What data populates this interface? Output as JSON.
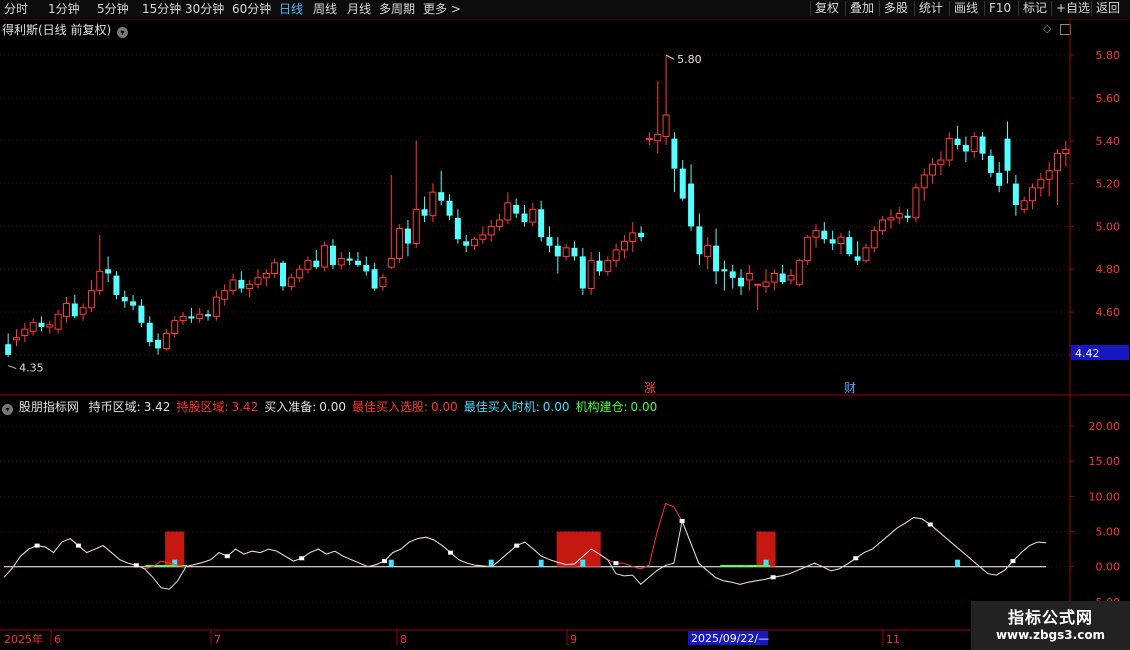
{
  "toolbar": {
    "periods": [
      {
        "label": "分时",
        "active": false
      },
      {
        "label": "1分钟",
        "active": false
      },
      {
        "label": "5分钟",
        "active": false
      },
      {
        "label": "15分钟",
        "active": false
      },
      {
        "label": "30分钟",
        "active": false
      },
      {
        "label": "60分钟",
        "active": false
      },
      {
        "label": "日线",
        "active": true
      },
      {
        "label": "周线",
        "active": false
      },
      {
        "label": "月线",
        "active": false
      },
      {
        "label": "多周期",
        "active": false
      },
      {
        "label": "更多 >",
        "active": false
      }
    ],
    "actions": [
      "复权",
      "叠加",
      "多股",
      "统计",
      "画线",
      "F10",
      "标记",
      "+自选",
      "返回"
    ]
  },
  "main_pane": {
    "title": "得利斯(日线 前复权)",
    "y_ticks": [
      "5.80",
      "5.60",
      "5.40",
      "5.20",
      "5.00",
      "4.80",
      "4.60",
      "4.40"
    ],
    "current_price": "4.42",
    "high_label": "5.80",
    "low_label": "4.35",
    "markers": [
      {
        "label": "涨",
        "color": "#ff4040"
      },
      {
        "label": "财",
        "color": "#4fa8ff"
      }
    ]
  },
  "indicator_pane": {
    "name": "股朋指标网",
    "legend": [
      {
        "label": "持币区域:",
        "value": "3.42",
        "color": "#e0e0e0"
      },
      {
        "label": "持股区域:",
        "value": "3.42",
        "color": "#ff3030"
      },
      {
        "label": "买入准备:",
        "value": "0.00",
        "color": "#e0e0e0"
      },
      {
        "label": "最佳买入选股:",
        "value": "0.00",
        "color": "#ff3030"
      },
      {
        "label": "最佳买入时机:",
        "value": "0.00",
        "color": "#40e0ff"
      },
      {
        "label": "机构建仓:",
        "value": "0.00",
        "color": "#40ff40"
      }
    ],
    "y_ticks": [
      "20.00",
      "15.00",
      "10.00",
      "5.00",
      "0.00",
      "-5.00"
    ]
  },
  "x_axis": {
    "year_label": "2025年",
    "month_labels": [
      "6",
      "7",
      "8",
      "9",
      "11"
    ],
    "cursor_date": "2025/09/22/—"
  },
  "watermark": {
    "line1": "指标公式网",
    "line2": "www.zbgs3.com"
  },
  "colors": {
    "up": "#ff3a3a",
    "down": "#54ffff",
    "grid": "#5a0000",
    "axis": "#a00000"
  },
  "chart_data": [
    {
      "type": "candlestick",
      "title": "得利斯(日线 前复权)",
      "ylim": [
        4.32,
        5.88
      ],
      "y_ticks": [
        5.8,
        5.6,
        5.4,
        5.2,
        5.0,
        4.8,
        4.6,
        4.4
      ],
      "ohlc": [
        [
          4.45,
          4.5,
          4.39,
          4.4
        ],
        [
          4.47,
          4.52,
          4.44,
          4.48
        ],
        [
          4.49,
          4.55,
          4.46,
          4.52
        ],
        [
          4.51,
          4.57,
          4.49,
          4.55
        ],
        [
          4.55,
          4.58,
          4.51,
          4.53
        ],
        [
          4.53,
          4.56,
          4.5,
          4.54
        ],
        [
          4.52,
          4.61,
          4.5,
          4.59
        ],
        [
          4.58,
          4.67,
          4.55,
          4.64
        ],
        [
          4.64,
          4.68,
          4.57,
          4.58
        ],
        [
          4.59,
          4.64,
          4.56,
          4.62
        ],
        [
          4.62,
          4.75,
          4.6,
          4.7
        ],
        [
          4.7,
          4.96,
          4.68,
          4.79
        ],
        [
          4.8,
          4.86,
          4.74,
          4.78
        ],
        [
          4.77,
          4.79,
          4.66,
          4.68
        ],
        [
          4.67,
          4.7,
          4.62,
          4.65
        ],
        [
          4.65,
          4.68,
          4.61,
          4.63
        ],
        [
          4.63,
          4.66,
          4.53,
          4.55
        ],
        [
          4.55,
          4.58,
          4.44,
          4.46
        ],
        [
          4.47,
          4.5,
          4.4,
          4.43
        ],
        [
          4.43,
          4.52,
          4.42,
          4.5
        ],
        [
          4.5,
          4.58,
          4.48,
          4.56
        ],
        [
          4.56,
          4.6,
          4.54,
          4.58
        ],
        [
          4.58,
          4.62,
          4.55,
          4.57
        ],
        [
          4.57,
          4.62,
          4.55,
          4.59
        ],
        [
          4.59,
          4.61,
          4.56,
          4.58
        ],
        [
          4.58,
          4.7,
          4.56,
          4.67
        ],
        [
          4.66,
          4.73,
          4.63,
          4.7
        ],
        [
          4.7,
          4.78,
          4.68,
          4.75
        ],
        [
          4.75,
          4.79,
          4.69,
          4.71
        ],
        [
          4.71,
          4.75,
          4.67,
          4.73
        ],
        [
          4.73,
          4.8,
          4.71,
          4.76
        ],
        [
          4.76,
          4.8,
          4.72,
          4.78
        ],
        [
          4.78,
          4.85,
          4.76,
          4.83
        ],
        [
          4.83,
          4.84,
          4.7,
          4.72
        ],
        [
          4.72,
          4.78,
          4.7,
          4.76
        ],
        [
          4.76,
          4.82,
          4.74,
          4.8
        ],
        [
          4.8,
          4.86,
          4.78,
          4.84
        ],
        [
          4.84,
          4.89,
          4.8,
          4.81
        ],
        [
          4.81,
          4.93,
          4.79,
          4.91
        ],
        [
          4.91,
          4.94,
          4.8,
          4.82
        ],
        [
          4.82,
          4.88,
          4.8,
          4.85
        ],
        [
          4.85,
          4.88,
          4.82,
          4.84
        ],
        [
          4.84,
          4.88,
          4.81,
          4.82
        ],
        [
          4.82,
          4.86,
          4.77,
          4.79
        ],
        [
          4.8,
          4.83,
          4.7,
          4.71
        ],
        [
          4.72,
          4.78,
          4.7,
          4.76
        ],
        [
          4.81,
          5.24,
          4.8,
          4.85
        ],
        [
          4.85,
          5.01,
          4.83,
          4.99
        ],
        [
          4.99,
          5.03,
          4.86,
          4.92
        ],
        [
          4.92,
          5.4,
          4.9,
          5.08
        ],
        [
          5.08,
          5.14,
          5.02,
          5.05
        ],
        [
          5.05,
          5.2,
          5.02,
          5.16
        ],
        [
          5.16,
          5.26,
          5.1,
          5.12
        ],
        [
          5.12,
          5.15,
          5.03,
          5.05
        ],
        [
          5.04,
          5.08,
          4.92,
          4.94
        ],
        [
          4.93,
          4.96,
          4.88,
          4.91
        ],
        [
          4.91,
          4.95,
          4.89,
          4.94
        ],
        [
          4.94,
          5.0,
          4.92,
          4.96
        ],
        [
          4.96,
          5.03,
          4.93,
          5.0
        ],
        [
          5.0,
          5.06,
          4.98,
          5.03
        ],
        [
          5.03,
          5.16,
          5.01,
          5.11
        ],
        [
          5.1,
          5.13,
          5.04,
          5.06
        ],
        [
          5.06,
          5.1,
          5.0,
          5.02
        ],
        [
          5.02,
          5.11,
          5.0,
          5.08
        ],
        [
          5.08,
          5.12,
          4.93,
          4.95
        ],
        [
          4.95,
          5.0,
          4.88,
          4.91
        ],
        [
          4.91,
          4.95,
          4.78,
          4.86
        ],
        [
          4.86,
          4.92,
          4.84,
          4.9
        ],
        [
          4.9,
          4.93,
          4.84,
          4.86
        ],
        [
          4.86,
          4.9,
          4.68,
          4.71
        ],
        [
          4.71,
          4.88,
          4.68,
          4.84
        ],
        [
          4.84,
          4.88,
          4.77,
          4.79
        ],
        [
          4.79,
          4.86,
          4.77,
          4.84
        ],
        [
          4.84,
          4.92,
          4.81,
          4.89
        ],
        [
          4.89,
          4.96,
          4.85,
          4.93
        ],
        [
          4.93,
          5.02,
          4.88,
          4.97
        ],
        [
          4.97,
          5.0,
          4.93,
          4.95
        ],
        [
          5.41,
          5.44,
          5.38,
          5.41
        ],
        [
          5.4,
          5.68,
          5.34,
          5.43
        ],
        [
          5.42,
          5.8,
          5.38,
          5.52
        ],
        [
          5.41,
          5.44,
          5.16,
          5.27
        ],
        [
          5.27,
          5.31,
          5.12,
          5.13
        ],
        [
          5.2,
          5.29,
          4.98,
          5.0
        ],
        [
          5.0,
          5.06,
          4.82,
          4.87
        ],
        [
          4.86,
          4.95,
          4.8,
          4.91
        ],
        [
          4.91,
          4.99,
          4.73,
          4.79
        ],
        [
          4.8,
          4.84,
          4.7,
          4.79
        ],
        [
          4.79,
          4.82,
          4.71,
          4.76
        ],
        [
          4.76,
          4.8,
          4.68,
          4.72
        ],
        [
          4.75,
          4.82,
          4.7,
          4.78
        ],
        [
          4.73,
          4.73,
          4.61,
          4.73
        ],
        [
          4.72,
          4.8,
          4.69,
          4.74
        ],
        [
          4.74,
          4.8,
          4.7,
          4.78
        ],
        [
          4.78,
          4.82,
          4.73,
          4.74
        ],
        [
          4.75,
          4.8,
          4.73,
          4.77
        ],
        [
          4.73,
          4.85,
          4.72,
          4.84
        ],
        [
          4.84,
          4.96,
          4.82,
          4.95
        ],
        [
          4.95,
          5.01,
          4.9,
          4.98
        ],
        [
          4.98,
          5.02,
          4.92,
          4.94
        ],
        [
          4.94,
          4.98,
          4.89,
          4.92
        ],
        [
          4.92,
          4.97,
          4.87,
          4.95
        ],
        [
          4.95,
          4.98,
          4.86,
          4.87
        ],
        [
          4.86,
          4.93,
          4.82,
          4.84
        ],
        [
          4.84,
          4.92,
          4.83,
          4.9
        ],
        [
          4.9,
          5.0,
          4.88,
          4.98
        ],
        [
          4.98,
          5.05,
          4.96,
          5.03
        ],
        [
          5.03,
          5.08,
          4.99,
          5.04
        ],
        [
          5.04,
          5.09,
          5.01,
          5.06
        ],
        [
          5.05,
          5.08,
          5.02,
          5.04
        ],
        [
          5.04,
          5.2,
          5.02,
          5.18
        ],
        [
          5.18,
          5.27,
          5.12,
          5.24
        ],
        [
          5.24,
          5.32,
          5.2,
          5.29
        ],
        [
          5.29,
          5.35,
          5.24,
          5.31
        ],
        [
          5.31,
          5.44,
          5.28,
          5.41
        ],
        [
          5.41,
          5.47,
          5.36,
          5.38
        ],
        [
          5.38,
          5.42,
          5.3,
          5.35
        ],
        [
          5.35,
          5.44,
          5.32,
          5.42
        ],
        [
          5.42,
          5.44,
          5.31,
          5.34
        ],
        [
          5.33,
          5.36,
          5.23,
          5.25
        ],
        [
          5.25,
          5.3,
          5.16,
          5.19
        ],
        [
          5.41,
          5.49,
          5.2,
          5.26
        ],
        [
          5.2,
          5.24,
          5.05,
          5.1
        ],
        [
          5.08,
          5.14,
          5.06,
          5.12
        ],
        [
          5.12,
          5.2,
          5.08,
          5.18
        ],
        [
          5.18,
          5.25,
          5.14,
          5.22
        ],
        [
          5.22,
          5.3,
          5.14,
          5.26
        ],
        [
          5.26,
          5.36,
          5.1,
          5.34
        ],
        [
          5.34,
          5.4,
          5.28,
          5.36
        ]
      ],
      "price_markers": {
        "high": 5.8,
        "low": 4.35,
        "current": 4.42
      }
    },
    {
      "type": "line",
      "title": "股朋指标网",
      "ylim": [
        -9,
        22
      ],
      "y_ticks": [
        20,
        15,
        10,
        5,
        0,
        -5
      ],
      "series": [
        {
          "name": "持股区域",
          "color": "#ff3030",
          "values": [
            -1.5,
            -0.2,
            1.5,
            2.5,
            3,
            2.8,
            2.0,
            3.5,
            4.0,
            3.0,
            2.0,
            2.5,
            3.0,
            2.0,
            1.0,
            0.5,
            0.2,
            -0.3,
            0.0,
            0.8,
            0.5,
            0.2,
            0.0,
            0.3,
            0.6,
            1.0,
            2.0,
            1.5,
            2.5,
            1.8,
            2.2,
            2.0,
            2.5,
            2.2,
            1.5,
            0.8,
            1.2,
            2.0,
            2.5,
            1.8,
            2.2,
            1.5,
            1.0,
            0.5,
            0.0,
            0.3,
            0.8,
            2.0,
            2.5,
            3.5,
            4.0,
            4.2,
            3.8,
            3.0,
            2.0,
            1.0,
            0.5,
            0.2,
            0.1,
            0.0,
            1.0,
            2.0,
            3.0,
            3.5,
            2.5,
            1.5,
            1.0,
            0.6,
            0.3,
            0.4,
            1.5,
            2.5,
            1.8,
            1.0,
            0.5,
            0.5,
            0.0,
            -0.3,
            0.2,
            5.0,
            9.0,
            8.5,
            6.5,
            3.5,
            0.5,
            -0.5,
            -1.5,
            -2.0,
            -2.2,
            -2.5,
            -2.2,
            -2.0,
            -1.8,
            -1.5,
            -1.3,
            -1.0,
            -0.5,
            0.0,
            0.5,
            0.0,
            -0.6,
            -0.3,
            0.4,
            1.2,
            2.0,
            2.5,
            3.5,
            4.5,
            5.5,
            6.2,
            7.0,
            6.8,
            6.0,
            5.0,
            4.0,
            3.0,
            2.0,
            1.0,
            0.0,
            -1.0,
            -1.2,
            -0.5,
            0.8,
            2.0,
            3.0,
            3.5,
            3.4
          ]
        },
        {
          "name": "持币区域",
          "color": "#e0e0e0",
          "values": [
            -1.5,
            -0.2,
            1.5,
            2.5,
            3,
            2.8,
            2.0,
            3.5,
            4.0,
            3.0,
            2.0,
            2.5,
            3.0,
            2.0,
            1.0,
            0.5,
            0.2,
            -0.3,
            -1.5,
            -3.0,
            -3.2,
            -2.0,
            0.0,
            0.3,
            0.6,
            1.0,
            2.0,
            1.5,
            2.5,
            1.8,
            2.2,
            2.0,
            2.5,
            2.2,
            1.5,
            0.8,
            1.2,
            2.0,
            2.5,
            1.8,
            2.2,
            1.5,
            1.0,
            0.5,
            0.0,
            0.3,
            0.8,
            2.0,
            2.5,
            3.5,
            4.0,
            4.2,
            3.8,
            3.0,
            2.0,
            1.0,
            0.5,
            0.2,
            0.1,
            0.0,
            1.0,
            2.0,
            3.0,
            3.5,
            2.5,
            1.5,
            1.0,
            0.6,
            0.3,
            0.4,
            1.5,
            2.5,
            1.8,
            1.0,
            -1.0,
            -1.3,
            -1.2,
            -2.5,
            -1.5,
            -0.5,
            0.2,
            0.5,
            6.5,
            3.5,
            0.5,
            -0.5,
            -1.5,
            -2.0,
            -2.2,
            -2.5,
            -2.2,
            -2.0,
            -1.8,
            -1.5,
            -1.3,
            -1.0,
            -0.5,
            0.0,
            0.5,
            0.0,
            -0.6,
            -0.3,
            0.4,
            1.2,
            2.0,
            2.5,
            3.5,
            4.5,
            5.5,
            6.2,
            7.0,
            6.8,
            6.0,
            5.0,
            4.0,
            3.0,
            2.0,
            1.0,
            0.0,
            -1.0,
            -1.2,
            -0.5,
            0.8,
            2.0,
            3.0,
            3.5,
            3.4
          ]
        }
      ],
      "bars": [
        {
          "name": "最佳买入选股",
          "color": "#c41810",
          "height": 5,
          "at": [
            20,
            67,
            68,
            70,
            91
          ]
        },
        {
          "name": "最佳买入时机",
          "color": "#40e0ff",
          "height": 1,
          "at": [
            20,
            46,
            58,
            64,
            69,
            91,
            114
          ]
        },
        {
          "name": "机构建仓",
          "color": "#40ff40",
          "height": 0.25,
          "at": [
            17,
            18,
            19,
            20,
            21,
            86,
            87,
            88,
            89,
            90,
            91
          ]
        }
      ]
    }
  ]
}
